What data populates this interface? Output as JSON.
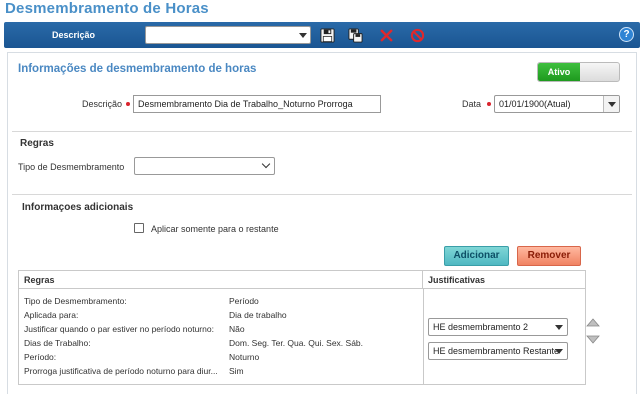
{
  "page_title": "Desmembramento de Horas",
  "toolbar": {
    "label": "Descrição",
    "select_value": "",
    "icons": [
      "save-icon",
      "save-copy-icon",
      "delete-icon",
      "cancel-icon",
      "help-icon"
    ],
    "help_label": "?"
  },
  "form": {
    "section_title": "Informações de desmembramento de horas",
    "active_toggle": "Ativo",
    "description_label": "Descrição",
    "description_value": "Desmembramento Dia de Trabalho_Noturno Prorroga",
    "date_label": "Data",
    "date_value": "01/01/1900(Atual)"
  },
  "regras": {
    "title": "Regras",
    "tipo_label": "Tipo de Desmembramento",
    "tipo_value": ""
  },
  "info": {
    "title": "Informaçoes adicionais",
    "checkbox_label": "Aplicar somente para o restante",
    "checked": false
  },
  "buttons": {
    "add": "Adicionar",
    "remove": "Remover"
  },
  "grid": {
    "col_rules": "Regras",
    "col_justifications": "Justificativas",
    "rows": [
      {
        "label": "Tipo de Desmembramento:",
        "value": "Período"
      },
      {
        "label": "Aplicada para:",
        "value": "Dia de trabalho"
      },
      {
        "label": "Justificar quando o par estiver no período noturno:",
        "value": "Não"
      },
      {
        "label": "Dias de Trabalho:",
        "value": "Dom. Seg. Ter. Qua. Qui. Sex. Sáb."
      },
      {
        "label": "Período:",
        "value": "Noturno"
      },
      {
        "label": "Prorroga justificativa de período noturno para diur...",
        "value": "Sim"
      }
    ],
    "justifications": [
      "HE desmembramento 2",
      "HE desmembramento Restante"
    ]
  },
  "colors": {
    "toolbar": "#1a5592",
    "title": "#4a90c8",
    "active": "#1e9a1e",
    "add": "#4fb8c2",
    "remove": "#f08262"
  }
}
